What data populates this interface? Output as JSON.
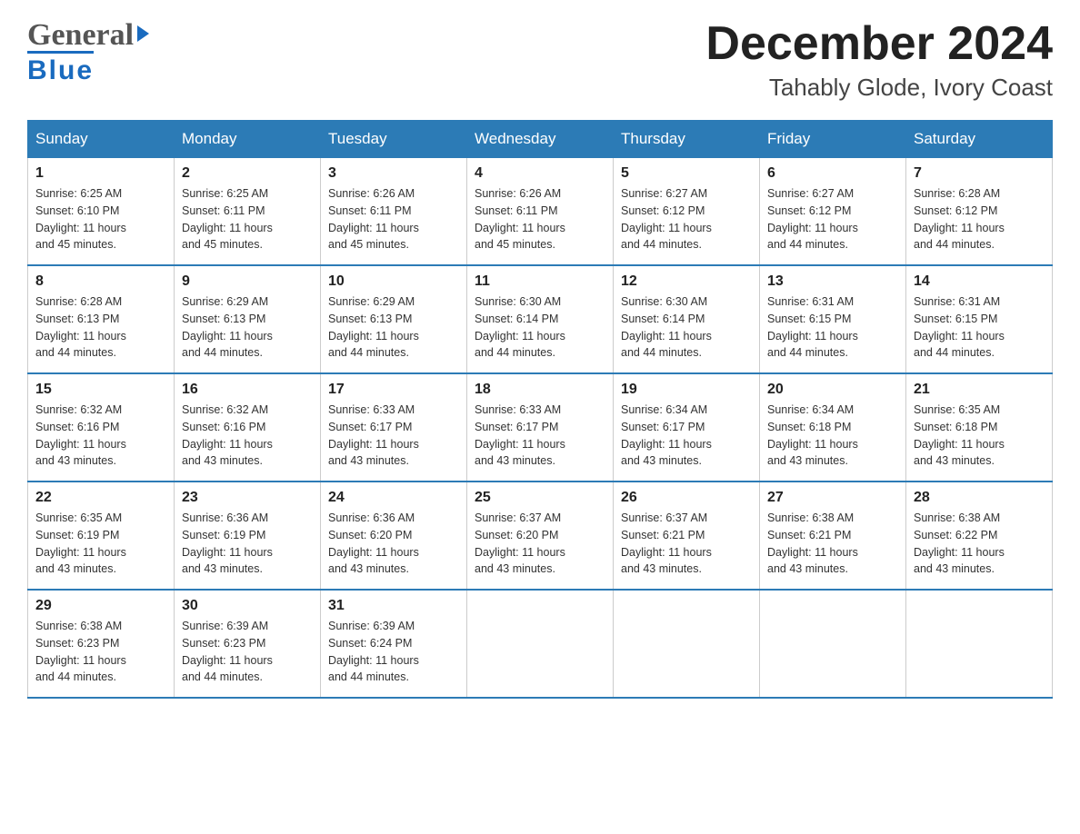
{
  "logo": {
    "line1": "General",
    "line2": "Blue",
    "triangle": "▶"
  },
  "title": "December 2024",
  "subtitle": "Tahably Glode, Ivory Coast",
  "days": [
    "Sunday",
    "Monday",
    "Tuesday",
    "Wednesday",
    "Thursday",
    "Friday",
    "Saturday"
  ],
  "weeks": [
    [
      {
        "num": "1",
        "sunrise": "6:25 AM",
        "sunset": "6:10 PM",
        "daylight": "11 hours and 45 minutes."
      },
      {
        "num": "2",
        "sunrise": "6:25 AM",
        "sunset": "6:11 PM",
        "daylight": "11 hours and 45 minutes."
      },
      {
        "num": "3",
        "sunrise": "6:26 AM",
        "sunset": "6:11 PM",
        "daylight": "11 hours and 45 minutes."
      },
      {
        "num": "4",
        "sunrise": "6:26 AM",
        "sunset": "6:11 PM",
        "daylight": "11 hours and 45 minutes."
      },
      {
        "num": "5",
        "sunrise": "6:27 AM",
        "sunset": "6:12 PM",
        "daylight": "11 hours and 44 minutes."
      },
      {
        "num": "6",
        "sunrise": "6:27 AM",
        "sunset": "6:12 PM",
        "daylight": "11 hours and 44 minutes."
      },
      {
        "num": "7",
        "sunrise": "6:28 AM",
        "sunset": "6:12 PM",
        "daylight": "11 hours and 44 minutes."
      }
    ],
    [
      {
        "num": "8",
        "sunrise": "6:28 AM",
        "sunset": "6:13 PM",
        "daylight": "11 hours and 44 minutes."
      },
      {
        "num": "9",
        "sunrise": "6:29 AM",
        "sunset": "6:13 PM",
        "daylight": "11 hours and 44 minutes."
      },
      {
        "num": "10",
        "sunrise": "6:29 AM",
        "sunset": "6:13 PM",
        "daylight": "11 hours and 44 minutes."
      },
      {
        "num": "11",
        "sunrise": "6:30 AM",
        "sunset": "6:14 PM",
        "daylight": "11 hours and 44 minutes."
      },
      {
        "num": "12",
        "sunrise": "6:30 AM",
        "sunset": "6:14 PM",
        "daylight": "11 hours and 44 minutes."
      },
      {
        "num": "13",
        "sunrise": "6:31 AM",
        "sunset": "6:15 PM",
        "daylight": "11 hours and 44 minutes."
      },
      {
        "num": "14",
        "sunrise": "6:31 AM",
        "sunset": "6:15 PM",
        "daylight": "11 hours and 44 minutes."
      }
    ],
    [
      {
        "num": "15",
        "sunrise": "6:32 AM",
        "sunset": "6:16 PM",
        "daylight": "11 hours and 43 minutes."
      },
      {
        "num": "16",
        "sunrise": "6:32 AM",
        "sunset": "6:16 PM",
        "daylight": "11 hours and 43 minutes."
      },
      {
        "num": "17",
        "sunrise": "6:33 AM",
        "sunset": "6:17 PM",
        "daylight": "11 hours and 43 minutes."
      },
      {
        "num": "18",
        "sunrise": "6:33 AM",
        "sunset": "6:17 PM",
        "daylight": "11 hours and 43 minutes."
      },
      {
        "num": "19",
        "sunrise": "6:34 AM",
        "sunset": "6:17 PM",
        "daylight": "11 hours and 43 minutes."
      },
      {
        "num": "20",
        "sunrise": "6:34 AM",
        "sunset": "6:18 PM",
        "daylight": "11 hours and 43 minutes."
      },
      {
        "num": "21",
        "sunrise": "6:35 AM",
        "sunset": "6:18 PM",
        "daylight": "11 hours and 43 minutes."
      }
    ],
    [
      {
        "num": "22",
        "sunrise": "6:35 AM",
        "sunset": "6:19 PM",
        "daylight": "11 hours and 43 minutes."
      },
      {
        "num": "23",
        "sunrise": "6:36 AM",
        "sunset": "6:19 PM",
        "daylight": "11 hours and 43 minutes."
      },
      {
        "num": "24",
        "sunrise": "6:36 AM",
        "sunset": "6:20 PM",
        "daylight": "11 hours and 43 minutes."
      },
      {
        "num": "25",
        "sunrise": "6:37 AM",
        "sunset": "6:20 PM",
        "daylight": "11 hours and 43 minutes."
      },
      {
        "num": "26",
        "sunrise": "6:37 AM",
        "sunset": "6:21 PM",
        "daylight": "11 hours and 43 minutes."
      },
      {
        "num": "27",
        "sunrise": "6:38 AM",
        "sunset": "6:21 PM",
        "daylight": "11 hours and 43 minutes."
      },
      {
        "num": "28",
        "sunrise": "6:38 AM",
        "sunset": "6:22 PM",
        "daylight": "11 hours and 43 minutes."
      }
    ],
    [
      {
        "num": "29",
        "sunrise": "6:38 AM",
        "sunset": "6:23 PM",
        "daylight": "11 hours and 44 minutes."
      },
      {
        "num": "30",
        "sunrise": "6:39 AM",
        "sunset": "6:23 PM",
        "daylight": "11 hours and 44 minutes."
      },
      {
        "num": "31",
        "sunrise": "6:39 AM",
        "sunset": "6:24 PM",
        "daylight": "11 hours and 44 minutes."
      },
      null,
      null,
      null,
      null
    ]
  ],
  "labels": {
    "sunrise": "Sunrise:",
    "sunset": "Sunset:",
    "daylight": "Daylight:"
  }
}
